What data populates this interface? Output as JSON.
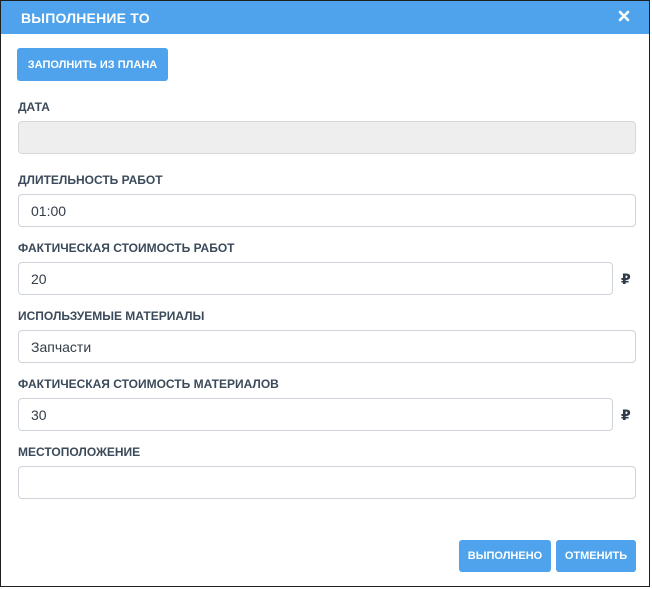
{
  "dialog": {
    "title": "ВЫПОЛНЕНИЕ ТО",
    "close_icon": "close-icon",
    "accent_color": "#4ea3ec"
  },
  "fill_from_plan_label": "ЗАПОЛНИТЬ ИЗ ПЛАНА",
  "fields": {
    "date": {
      "label": "ДАТА",
      "value": ""
    },
    "duration": {
      "label": "ДЛИТЕЛЬНОСТЬ РАБОТ",
      "value": "01:00"
    },
    "work_cost": {
      "label": "ФАКТИЧЕСКАЯ СТОИМОСТЬ РАБОТ",
      "value": "20",
      "currency": "₽"
    },
    "materials": {
      "label": "ИСПОЛЬЗУЕМЫЕ МАТЕРИАЛЫ",
      "value": "Запчасти"
    },
    "materials_cost": {
      "label": "ФАКТИЧЕСКАЯ СТОИМОСТЬ МАТЕРИАЛОВ",
      "value": "30",
      "currency": "₽"
    },
    "location": {
      "label": "МЕСТОПОЛОЖЕНИЕ",
      "value": ""
    }
  },
  "footer": {
    "done_label": "ВЫПОЛНЕНО",
    "cancel_label": "ОТМЕНИТЬ"
  }
}
